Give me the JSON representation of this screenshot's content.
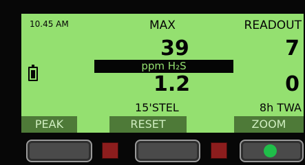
{
  "status": {
    "time": "10.45 AM"
  },
  "labels": {
    "max": "MAX",
    "readout": "READOUT",
    "stel": "15'STEL",
    "twa": "8h TWA"
  },
  "values": {
    "max": "39",
    "readout": "7",
    "stel": "1.2",
    "twa": "0"
  },
  "unit": "ppm H₂S",
  "softkeys": {
    "left": "PEAK",
    "middle": "RESET",
    "right": "ZOOM"
  },
  "icons": {
    "battery": "battery-icon",
    "status_led": "status-led-icon",
    "alarm_led": "alarm-led-icon"
  },
  "colors": {
    "screen_bg": "#94e070",
    "softkey_bg": "#4e7a38",
    "alarm_led": "#8c1d1d",
    "status_led": "#1fbe49"
  }
}
